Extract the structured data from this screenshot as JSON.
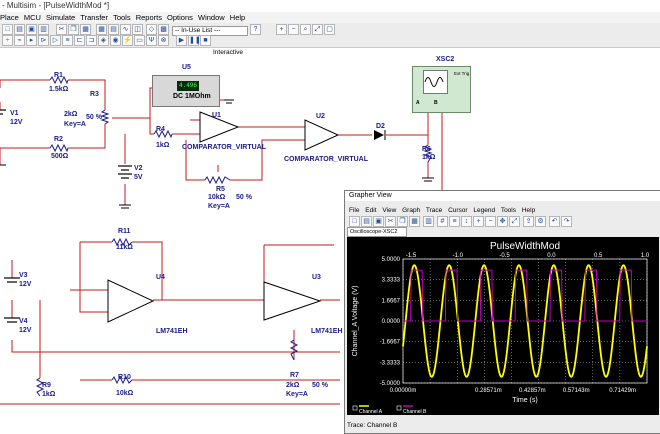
{
  "window": {
    "title": "- Multisim - [PulseWidthMod *]"
  },
  "menu": [
    "Place",
    "MCU",
    "Simulate",
    "Transfer",
    "Tools",
    "Reports",
    "Options",
    "Window",
    "Help"
  ],
  "toolbar": {
    "in_use_list": "-- In-Use List ---",
    "interactive": "Interactive"
  },
  "schematic": {
    "r1": {
      "name": "R1",
      "value": "1.5kΩ"
    },
    "r2": {
      "name": "R2",
      "value": "500Ω"
    },
    "r3": {
      "name": "R3",
      "value": "2kΩ",
      "key": "Key=A",
      "pct": "50 %"
    },
    "v1": {
      "name": "V1",
      "value": "12V"
    },
    "v2": {
      "name": "V2",
      "value": "5V"
    },
    "u5": {
      "name": "U5",
      "reading": "4.496",
      "caption": "DC  1MOhm"
    },
    "r4": {
      "name": "R4",
      "value": "1kΩ"
    },
    "u1": {
      "name": "U1",
      "type": "COMPARATOR_VIRTUAL"
    },
    "u2": {
      "name": "U2",
      "type": "COMPARATOR_VIRTUAL"
    },
    "d2": {
      "name": "D2"
    },
    "xsc2": {
      "name": "XSC2",
      "trig": "Ext Trig",
      "ch_a": "A",
      "ch_b": "B"
    },
    "r6": {
      "name": "R6",
      "value": "1kΩ"
    },
    "r5": {
      "name": "R5",
      "value": "10kΩ",
      "pct": "50 %",
      "key": "Key=A"
    },
    "r11": {
      "name": "R11",
      "value": "11kΩ"
    },
    "v3": {
      "name": "V3",
      "value": "12V"
    },
    "v4": {
      "name": "V4",
      "value": "12V"
    },
    "u4": {
      "name": "U4",
      "type": "LM741EH"
    },
    "u3": {
      "name": "U3",
      "type": "LM741EH"
    },
    "r9": {
      "name": "R9",
      "value": "1kΩ"
    },
    "r10": {
      "name": "R10",
      "value": "10kΩ"
    },
    "r7": {
      "name": "R7",
      "value": "2kΩ",
      "pct": "50 %",
      "key": "Key=A"
    }
  },
  "grapher": {
    "window_title": "Grapher View",
    "menu": [
      "File",
      "Edit",
      "View",
      "Graph",
      "Trace",
      "Cursor",
      "Legend",
      "Tools",
      "Help"
    ],
    "tab": "Oscilloscope-XSC2",
    "status": "Trace: Channel B",
    "colors": {
      "channel_a": "#ffff00",
      "channel_b": "#c000c0",
      "background": "#000000",
      "grid": "#ffffff"
    }
  },
  "chart_data": {
    "type": "line",
    "title": "PulseWidthMod",
    "xlabel": "Time (s)",
    "ylabel": "Channel_A Voltage (V)",
    "x_tick_labels": [
      "0.00000m",
      "0.28571m",
      "0.42857m",
      "0.57143m",
      "0.71429m"
    ],
    "top_tick_labels": [
      "-1.5",
      "-1.0",
      "-0.5",
      "0.0",
      "0.5",
      "1.0"
    ],
    "y_tick_labels": [
      "5.0000",
      "3.3333",
      "1.6667",
      "0.0000",
      "-1.6667",
      "-3.3333",
      "-5.0000"
    ],
    "ylim": [
      -5,
      5
    ],
    "xlim": [
      0,
      1
    ],
    "grid": true,
    "legend_position": "bottom-left",
    "series": [
      {
        "name": "Channel A",
        "color": "#ffff00",
        "shape": "sine",
        "amplitude": 4.5,
        "cycles": 7
      },
      {
        "name": "Channel B",
        "color": "#c000c0",
        "shape": "square",
        "high": 4.1,
        "low": 0,
        "cycles": 7
      }
    ]
  }
}
